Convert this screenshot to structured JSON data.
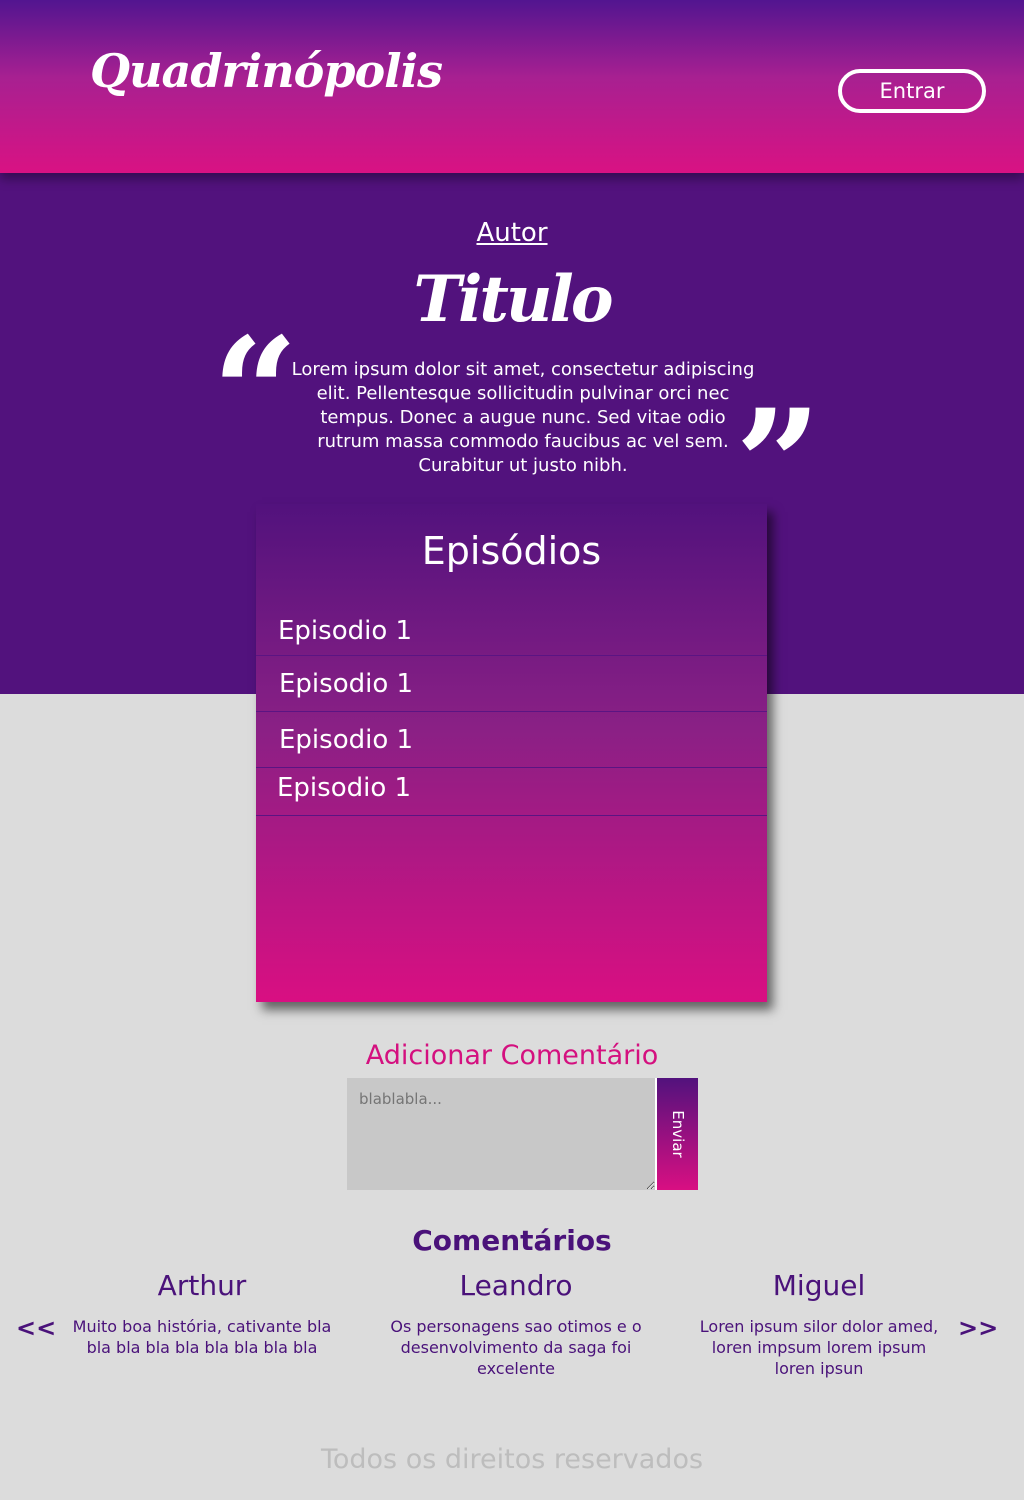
{
  "header": {
    "logo": "Quadrinópolis",
    "login_label": "Entrar"
  },
  "hero": {
    "author": "Autor",
    "title": "Titulo",
    "quote_open": "“",
    "quote_close": "”",
    "synopsis": "Lorem ipsum dolor sit amet, consectetur adipiscing elit. Pellentesque sollicitudin pulvinar orci nec tempus. Donec a augue nunc. Sed vitae odio rutrum massa commodo faucibus ac vel sem. Curabitur ut justo nibh."
  },
  "episodes": {
    "title": "Episódios",
    "items": [
      {
        "label": "Episodio 1"
      },
      {
        "label": "Episodio 1"
      },
      {
        "label": "Episodio 1"
      },
      {
        "label": "Episodio 1"
      }
    ]
  },
  "add_comment": {
    "title": "Adicionar Comentário",
    "placeholder": "blablabla...",
    "send_label": "Enviar"
  },
  "comments": {
    "title": "Comentários",
    "prev_label": "<<",
    "next_label": ">>",
    "items": [
      {
        "author": "Arthur",
        "text": "Muito boa história, cativante bla bla bla bla bla bla bla bla bla"
      },
      {
        "author": "Leandro",
        "text": "Os personagens sao otimos e o desenvolvimento da saga foi excelente"
      },
      {
        "author": "Miguel",
        "text": "Loren ipsum silor dolor amed, loren impsum lorem ipsum loren ipsun"
      }
    ]
  },
  "footer": {
    "text": "Todos os direitos reservados"
  },
  "colors": {
    "purple": "#52127d",
    "magenta": "#d90f82",
    "background": "#dcdcdc"
  }
}
